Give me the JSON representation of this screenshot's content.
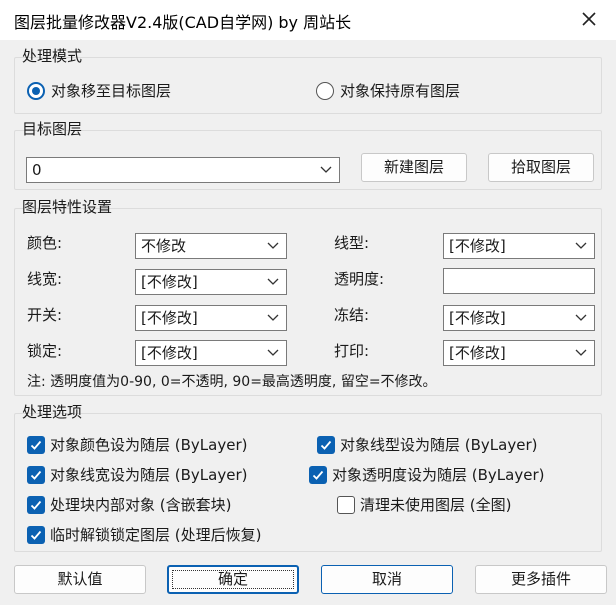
{
  "window": {
    "title": "图层批量修改器V2.4版(CAD自学网) by 周站长"
  },
  "mode": {
    "group_title": "处理模式",
    "options": [
      {
        "label": "对象移至目标图层",
        "selected": true
      },
      {
        "label": "对象保持原有图层",
        "selected": false
      }
    ]
  },
  "target": {
    "group_title": "目标图层",
    "select_value": "0",
    "new_layer_label": "新建图层",
    "pick_layer_label": "拾取图层"
  },
  "props": {
    "group_title": "图层特性设置",
    "color": {
      "label": "颜色:",
      "value": "不修改"
    },
    "linetype": {
      "label": "线型:",
      "value": "[不修改]"
    },
    "lineweight": {
      "label": "线宽:",
      "value": "[不修改]"
    },
    "transparency": {
      "label": "透明度:",
      "value": ""
    },
    "onoff": {
      "label": "开关:",
      "value": "[不修改]"
    },
    "freeze": {
      "label": "冻结:",
      "value": "[不修改]"
    },
    "lock": {
      "label": "锁定:",
      "value": "[不修改]"
    },
    "plot": {
      "label": "打印:",
      "value": "[不修改]"
    },
    "note": "注: 透明度值为0-90, 0=不透明, 90=最高透明度, 留空=不修改。"
  },
  "options": {
    "group_title": "处理选项",
    "items": [
      {
        "label": "对象颜色设为随层 (ByLayer)",
        "checked": true
      },
      {
        "label": "对象线型设为随层 (ByLayer)",
        "checked": true
      },
      {
        "label": "对象线宽设为随层 (ByLayer)",
        "checked": true
      },
      {
        "label": "对象透明度设为随层 (ByLayer)",
        "checked": true
      },
      {
        "label": "处理块内部对象 (含嵌套块)",
        "checked": true
      },
      {
        "label": "清理未使用图层 (全图)",
        "checked": false
      },
      {
        "label": "临时解锁锁定图层 (处理后恢复)",
        "checked": true
      }
    ]
  },
  "buttons": {
    "defaults": "默认值",
    "ok": "确定",
    "cancel": "取消",
    "more": "更多插件"
  },
  "colors": {
    "accent": "#0b61b2",
    "background": "#f0f0f0"
  }
}
